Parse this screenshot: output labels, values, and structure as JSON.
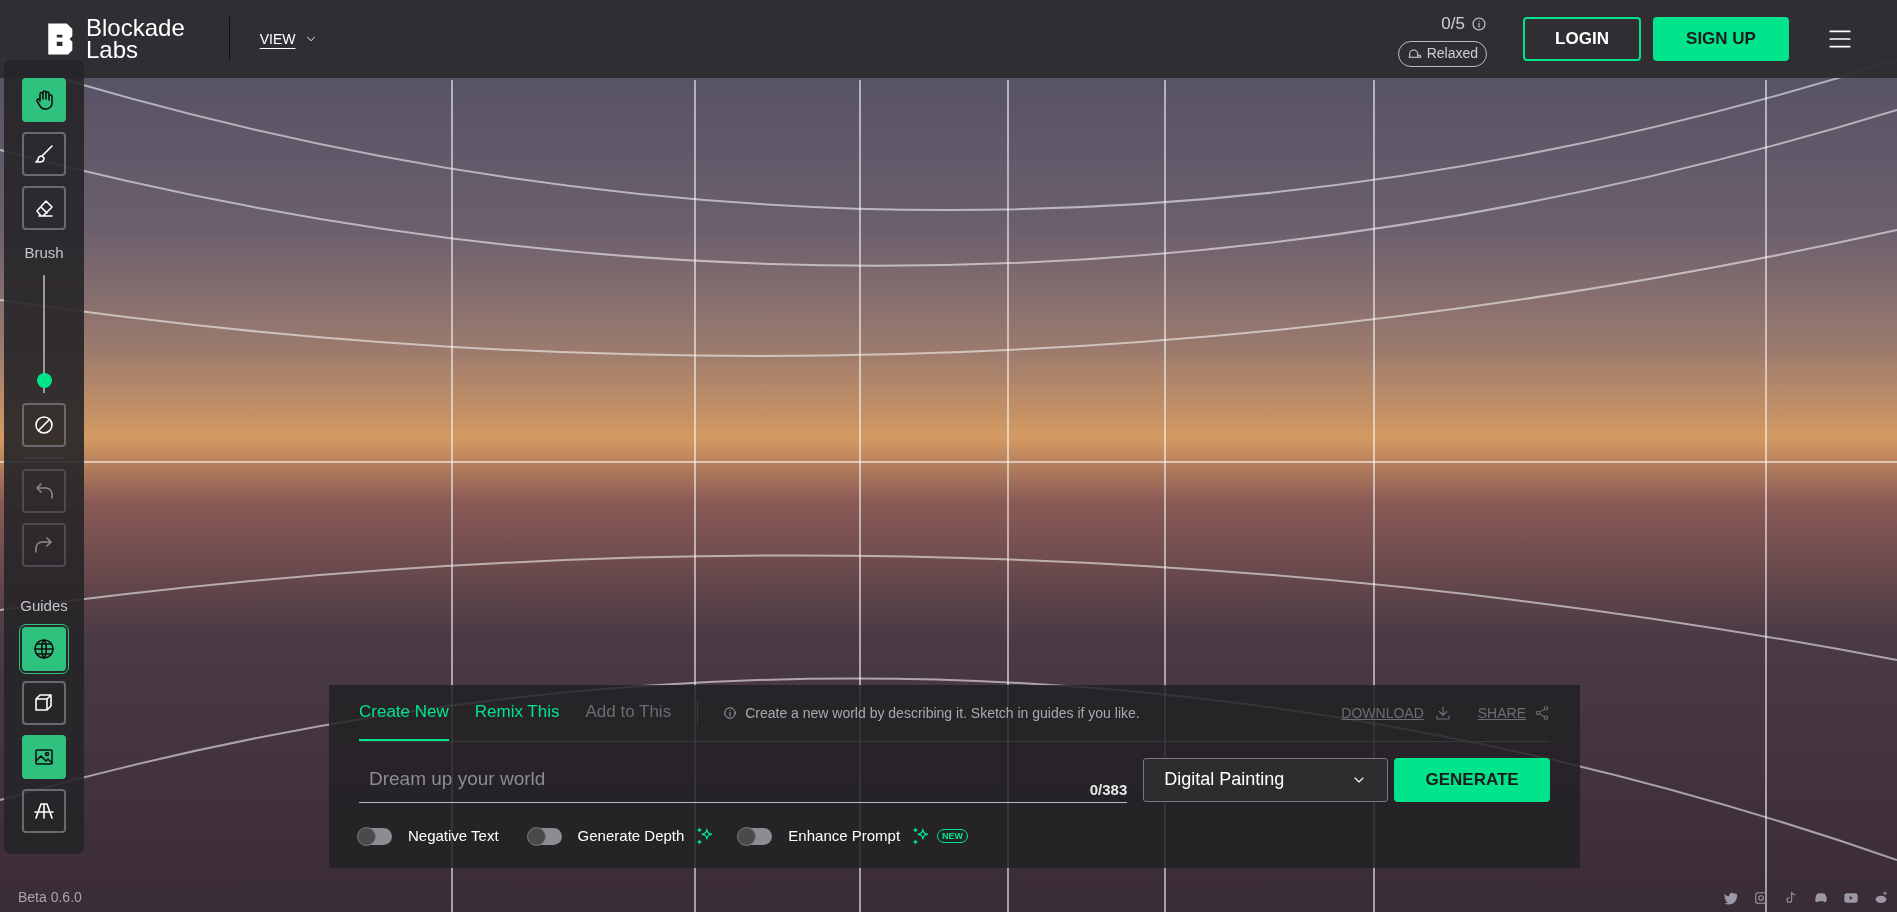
{
  "header": {
    "logo": [
      "Blockade",
      "Labs"
    ],
    "view_menu": "VIEW",
    "credits": "0/5",
    "queue": "Relaxed",
    "login": "LOGIN",
    "signup": "SIGN UP"
  },
  "toolbar": {
    "tools": [
      {
        "selected": true
      },
      {
        "selected": false
      },
      {
        "selected": false
      }
    ],
    "brush_label": "Brush",
    "brush_size": {
      "level": 0.05
    },
    "history": [
      {
        "disabled": true
      },
      {
        "disabled": true
      }
    ],
    "guides_label": "Guides",
    "guides": [
      {
        "selected": true
      },
      {
        "selected": false
      },
      {
        "selected": true
      },
      {
        "selected": false
      }
    ]
  },
  "panel": {
    "tabs": [
      {
        "label": "Create New",
        "selected": true,
        "disabled": false
      },
      {
        "label": "Remix This",
        "selected": false,
        "disabled": false
      },
      {
        "label": "Add to This",
        "selected": false,
        "disabled": true
      }
    ],
    "hint": "Create a new world by describing it. Sketch in guides if you like.",
    "download": "DOWNLOAD",
    "share": "SHARE",
    "prompt": {
      "placeholder": "Dream up your world"
    },
    "counter": "0/383",
    "style": "Digital Painting",
    "generate": "GENERATE",
    "toggles": [
      {
        "label": "Negative Text",
        "on": false,
        "sparkle": false
      },
      {
        "label": "Generate Depth",
        "on": false,
        "sparkle": true
      },
      {
        "label": "Enhance Prompt",
        "on": false,
        "sparkle": true,
        "badge": "NEW"
      }
    ]
  },
  "version": "Beta 0.6.0"
}
